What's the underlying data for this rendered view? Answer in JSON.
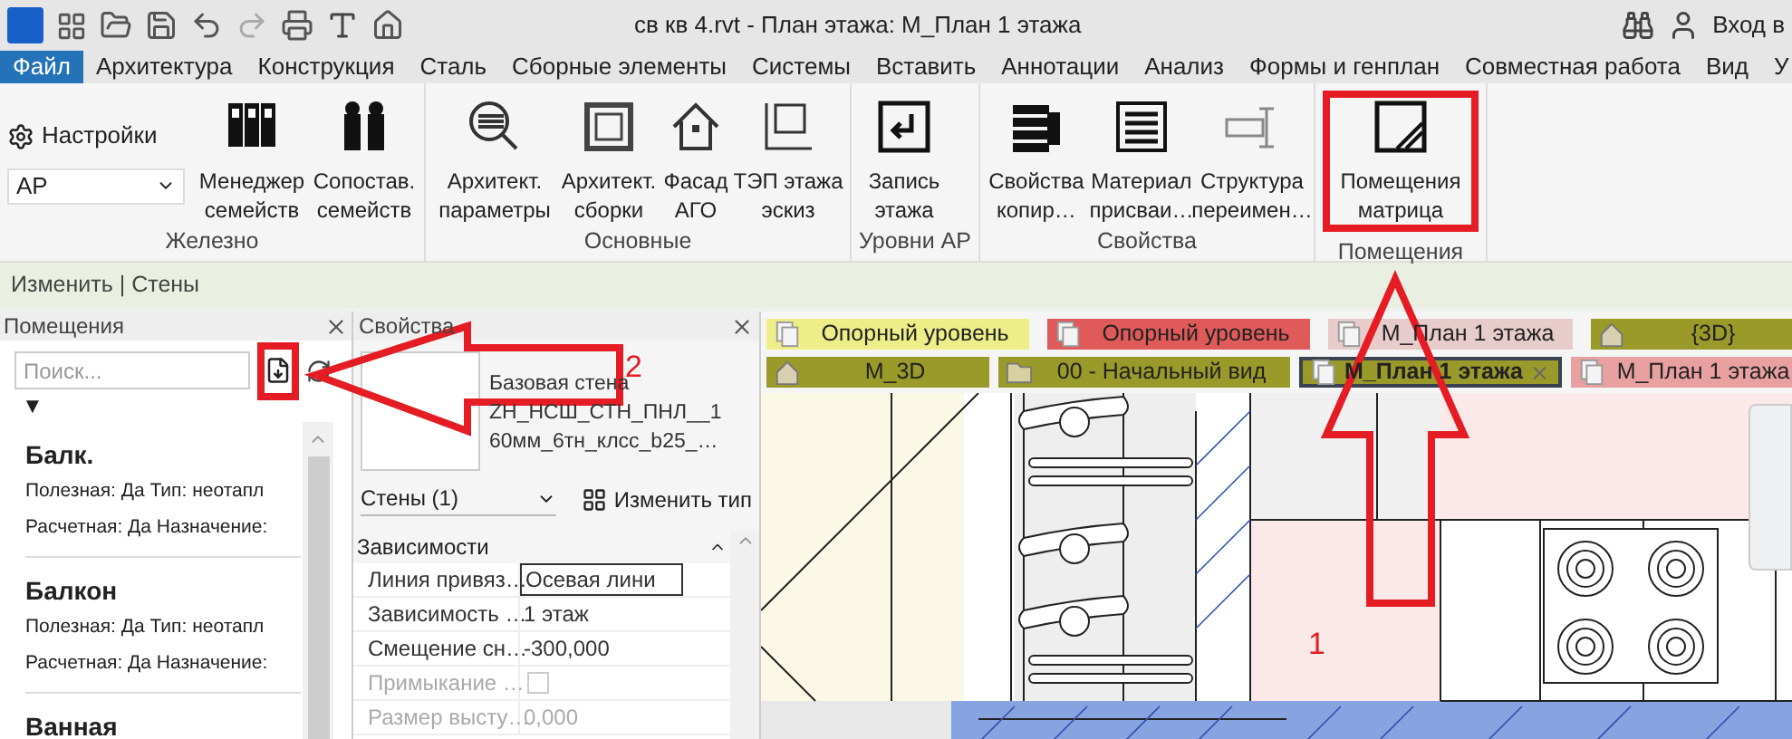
{
  "title_bar": {
    "title": "св кв 4.rvt - План этажа: М_План 1 этажа",
    "sign_in": "Вход в"
  },
  "menu_tabs": [
    {
      "label": "Файл",
      "selected": true
    },
    {
      "label": "Архитектура",
      "selected": false
    },
    {
      "label": "Конструкция",
      "selected": false
    },
    {
      "label": "Сталь",
      "selected": false
    },
    {
      "label": "Сборные элементы",
      "selected": false
    },
    {
      "label": "Системы",
      "selected": false
    },
    {
      "label": "Вставить",
      "selected": false
    },
    {
      "label": "Аннотации",
      "selected": false
    },
    {
      "label": "Анализ",
      "selected": false
    },
    {
      "label": "Формы и генплан",
      "selected": false
    },
    {
      "label": "Совместная работа",
      "selected": false
    },
    {
      "label": "Вид",
      "selected": false
    },
    {
      "label": "У",
      "selected": false
    }
  ],
  "ribbon": {
    "settings_label": "Настройки",
    "discipline_select": "АР",
    "panels": [
      {
        "title": "Железно",
        "buttons": [
          {
            "lines": [
              "Менеджер",
              "семейств"
            ]
          },
          {
            "lines": [
              "Сопостав.",
              "семейств"
            ]
          }
        ]
      },
      {
        "title": "Основные",
        "buttons": [
          {
            "lines": [
              "Архитект.",
              "параметры"
            ]
          },
          {
            "lines": [
              "Архитект.",
              "сборки"
            ]
          },
          {
            "lines": [
              "Фасад",
              "АГО"
            ]
          },
          {
            "lines": [
              "ТЭП этажа",
              "эскиз"
            ]
          }
        ]
      },
      {
        "title": "Уровни АР",
        "buttons": [
          {
            "lines": [
              "Запись",
              "этажа"
            ]
          }
        ]
      },
      {
        "title": "Свойства",
        "buttons": [
          {
            "lines": [
              "Свойства",
              "копир…"
            ]
          },
          {
            "lines": [
              "Материал",
              "присваи…"
            ]
          },
          {
            "lines": [
              "Структура",
              "переимен…"
            ]
          }
        ]
      },
      {
        "title": "Помещения",
        "buttons": [
          {
            "lines": [
              "Помещения",
              "матрица"
            ]
          }
        ]
      }
    ]
  },
  "context_bar": "Изменить | Стены",
  "rooms_panel": {
    "title": "Помещения",
    "search": {
      "placeholder": "Поиск..."
    },
    "toggle": "▼",
    "rooms": [
      {
        "name": "Балк.",
        "line1": "Полезная: Да Тип: неотапл",
        "line2": "Расчетная: Да Назначение:"
      },
      {
        "name": "Балкон",
        "line1": "Полезная: Да Тип: неотапл",
        "line2": "Расчетная: Да Назначение:"
      },
      {
        "name": "Ванная"
      }
    ]
  },
  "properties": {
    "title": "Свойства",
    "type_lines": [
      "Базовая стена",
      "ZH_НСШ_СТН_ПНЛ__1",
      "60мм_6тн_клсс_b25_…"
    ],
    "category": "Стены (1)",
    "edit_type": "Изменить тип",
    "section": "Зависимости",
    "rows": [
      {
        "label": "Линия привяз…",
        "value": "Осевая лини",
        "kind": "input",
        "disabled": false
      },
      {
        "label": "Зависимость …",
        "value": "1 этаж",
        "kind": "text",
        "disabled": false
      },
      {
        "label": "Смещение сн…",
        "value": "-300,000",
        "kind": "text",
        "disabled": false
      },
      {
        "label": "Примыкание …",
        "kind": "checkbox",
        "checked": false,
        "disabled": true
      },
      {
        "label": "Размер высту…",
        "value": "0,000",
        "kind": "text",
        "disabled": true
      }
    ]
  },
  "view_tabs": [
    [
      {
        "label": "Опорный уровень",
        "color": "#eeee88",
        "kind": "plan",
        "selected": false
      },
      {
        "label": "Опорный уровень",
        "color": "#e05a5a",
        "kind": "plan",
        "selected": false
      },
      {
        "label": "М_План 1 этажа",
        "color": "#e8cccc",
        "kind": "plan",
        "selected": false
      },
      {
        "label": "{3D}",
        "color": "#9a9a2a",
        "kind": "house",
        "selected": false
      }
    ],
    [
      {
        "label": "М_3D",
        "color": "#9a9a2a",
        "kind": "house",
        "selected": false
      },
      {
        "label": "00 - Начальный вид",
        "color": "#9a9a2a",
        "kind": "sheet",
        "selected": false
      },
      {
        "label": "М_План 1 этажа",
        "color": "#9a9a2a",
        "kind": "plan",
        "selected": true
      },
      {
        "label": "М_План 1 этажа",
        "color": "#e8a0a0",
        "kind": "plan",
        "selected": false
      }
    ]
  ],
  "annotations": [
    {
      "label": "2"
    },
    {
      "label": "1"
    }
  ]
}
